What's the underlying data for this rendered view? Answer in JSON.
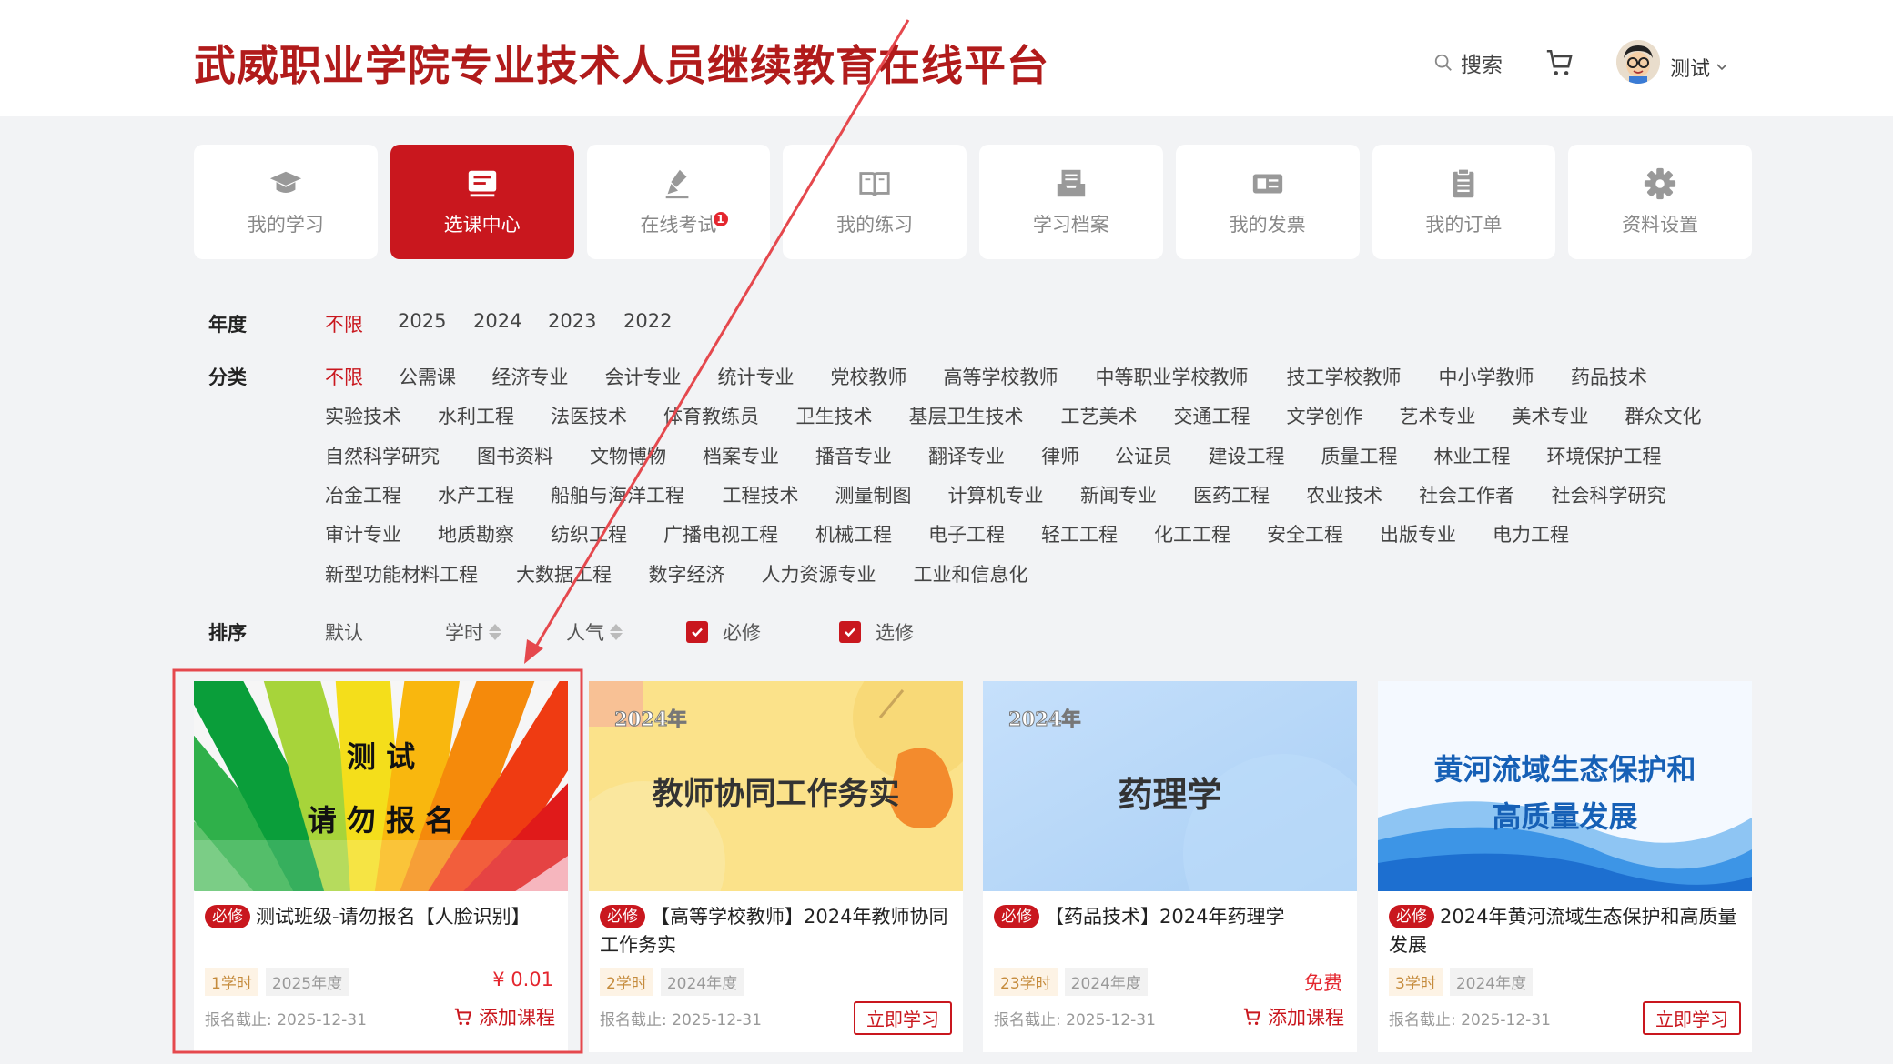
{
  "header": {
    "brand": "武威职业学院专业技术人员继续教育在线平台",
    "search_label": "搜索",
    "username": "测试"
  },
  "nav": [
    {
      "label": "我的学习",
      "icon": "graduation-cap-icon",
      "active": false
    },
    {
      "label": "选课中心",
      "icon": "course-center-icon",
      "active": true
    },
    {
      "label": "在线考试",
      "icon": "exam-pen-icon",
      "active": false,
      "badge": "1"
    },
    {
      "label": "我的练习",
      "icon": "open-book-icon",
      "active": false
    },
    {
      "label": "学习档案",
      "icon": "archive-tray-icon",
      "active": false
    },
    {
      "label": "我的发票",
      "icon": "invoice-ticket-icon",
      "active": false
    },
    {
      "label": "我的订单",
      "icon": "clipboard-icon",
      "active": false
    },
    {
      "label": "资料设置",
      "icon": "gear-icon",
      "active": false
    }
  ],
  "filters": {
    "year_label": "年度",
    "years": [
      "不限",
      "2025",
      "2024",
      "2023",
      "2022"
    ],
    "category_label": "分类",
    "categories": [
      [
        "不限",
        "公需课",
        "经济专业",
        "会计专业",
        "统计专业",
        "党校教师",
        "高等学校教师",
        "中等职业学校教师",
        "技工学校教师",
        "中小学教师",
        "药品技术"
      ],
      [
        "实验技术",
        "水利工程",
        "法医技术",
        "体育教练员",
        "卫生技术",
        "基层卫生技术",
        "工艺美术",
        "交通工程",
        "文学创作",
        "艺术专业",
        "美术专业",
        "群众文化"
      ],
      [
        "自然科学研究",
        "图书资料",
        "文物博物",
        "档案专业",
        "播音专业",
        "翻译专业",
        "律师",
        "公证员",
        "建设工程",
        "质量工程",
        "林业工程",
        "环境保护工程"
      ],
      [
        "冶金工程",
        "水产工程",
        "船舶与海洋工程",
        "工程技术",
        "测量制图",
        "计算机专业",
        "新闻专业",
        "医药工程",
        "农业技术",
        "社会工作者",
        "社会科学研究"
      ],
      [
        "审计专业",
        "地质勘察",
        "纺织工程",
        "广播电视工程",
        "机械工程",
        "电子工程",
        "轻工工程",
        "化工工程",
        "安全工程",
        "出版专业",
        "电力工程"
      ],
      [
        "新型功能材料工程",
        "大数据工程",
        "数字经济",
        "人力资源专业",
        "工业和信息化"
      ]
    ],
    "sort_label": "排序",
    "sort_default": "默认",
    "sort_hours": "学时",
    "sort_popular": "人气",
    "check_required": "必修",
    "check_elective": "选修"
  },
  "courses": [
    {
      "thumb_line1": "测 试",
      "thumb_line2": "请 勿 报 名",
      "badge": "必修",
      "title": "测试班级-请勿报名【人脸识别】",
      "hours": "1学时",
      "year": "2025年度",
      "price": "¥ 0.01",
      "deadline": "报名截止: 2025-12-31",
      "action": "添加课程"
    },
    {
      "thumb_year": "2024年",
      "thumb_title": "教师协同工作务实",
      "badge": "必修",
      "title": "【高等学校教师】2024年教师协同工作务实",
      "hours": "2学时",
      "year": "2024年度",
      "price": "",
      "deadline": "报名截止: 2025-12-31",
      "action": "立即学习"
    },
    {
      "thumb_year": "2024年",
      "thumb_title": "药理学",
      "badge": "必修",
      "title": "【药品技术】2024年药理学",
      "hours": "23学时",
      "year": "2024年度",
      "price": "免费",
      "deadline": "报名截止: 2025-12-31",
      "action": "添加课程"
    },
    {
      "thumb_line1": "黄河流域生态保护和",
      "thumb_line2": "高质量发展",
      "badge": "必修",
      "title": "2024年黄河流域生态保护和高质量发展",
      "hours": "3学时",
      "year": "2024年度",
      "price": "",
      "deadline": "报名截止: 2025-12-31",
      "action": "立即学习"
    }
  ],
  "colors": {
    "accent": "#c9171e",
    "annotation": "#e5484d"
  }
}
